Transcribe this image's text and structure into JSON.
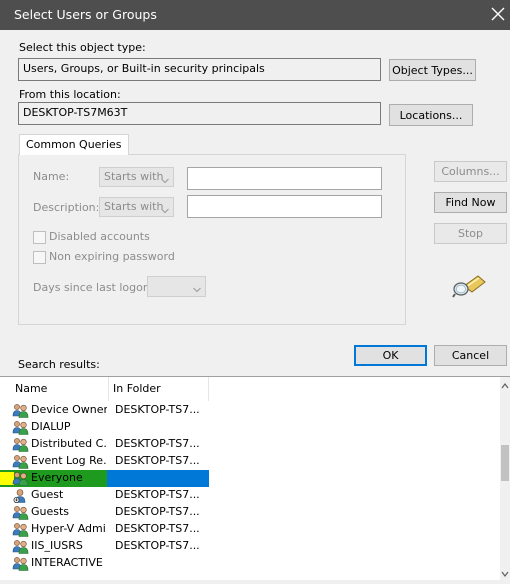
{
  "window": {
    "title": "Select Users or Groups"
  },
  "object_type": {
    "label": "Select this object type:",
    "value": "Users, Groups, or Built-in security principals",
    "button": "Object Types..."
  },
  "location": {
    "label": "From this location:",
    "value": "DESKTOP-TS7M63T",
    "button": "Locations..."
  },
  "queries": {
    "tab": "Common Queries",
    "name_label": "Name:",
    "name_mode": "Starts with",
    "description_label": "Description:",
    "description_mode": "Starts with",
    "disabled_accounts": "Disabled accounts",
    "non_expiring_password": "Non expiring password",
    "days_label": "Days since last logon:"
  },
  "side_buttons": {
    "columns": "Columns...",
    "find_now": "Find Now",
    "stop": "Stop"
  },
  "actions": {
    "ok": "OK",
    "cancel": "Cancel"
  },
  "results": {
    "label": "Search results:",
    "columns": [
      "Name",
      "In Folder"
    ],
    "rows": [
      {
        "name": "Device Owners",
        "folder": "DESKTOP-TS7..."
      },
      {
        "name": "DIALUP",
        "folder": ""
      },
      {
        "name": "Distributed C...",
        "folder": "DESKTOP-TS7..."
      },
      {
        "name": "Event Log Re...",
        "folder": "DESKTOP-TS7..."
      },
      {
        "name": "Everyone",
        "folder": "",
        "selected": true
      },
      {
        "name": "Guest",
        "folder": "DESKTOP-TS7...",
        "user": true
      },
      {
        "name": "Guests",
        "folder": "DESKTOP-TS7..."
      },
      {
        "name": "Hyper-V Admi...",
        "folder": "DESKTOP-TS7..."
      },
      {
        "name": "IIS_IUSRS",
        "folder": "DESKTOP-TS7..."
      },
      {
        "name": "INTERACTIVE",
        "folder": ""
      }
    ]
  },
  "colors": {
    "titlebar": "#4e4e4e",
    "accent": "#0078d7",
    "selection_name": "#1e9a1e",
    "highlight_marker": "#ffff00"
  },
  "icons": {
    "close": "close-icon",
    "search": "search-flashlight-icon",
    "group": "group-icon",
    "user": "user-icon",
    "dropdown": "chevron-down-icon"
  }
}
